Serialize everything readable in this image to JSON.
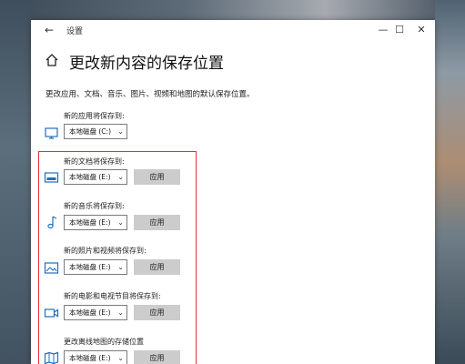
{
  "window": {
    "title": "设置",
    "back_glyph": "←",
    "minimize_glyph": "—",
    "maximize_glyph": "☐",
    "close_glyph": "✕"
  },
  "page": {
    "title": "更改新内容的保存位置",
    "description": "更改应用、文档、音乐、图片、视频和地图的默认保存位置。"
  },
  "rows": [
    {
      "label": "新的应用将保存到:",
      "drive": "本地磁盘 (C:)",
      "apply": "",
      "icon": "monitor-icon"
    },
    {
      "label": "新的文档将保存到:",
      "drive": "本地磁盘 (E:)",
      "apply": "应用",
      "icon": "document-drive-icon"
    },
    {
      "label": "新的音乐将保存到:",
      "drive": "本地磁盘 (E:)",
      "apply": "应用",
      "icon": "music-note-icon"
    },
    {
      "label": "新的照片和视频将保存到:",
      "drive": "本地磁盘 (E:)",
      "apply": "应用",
      "icon": "picture-icon"
    },
    {
      "label": "新的电影和电视节目将保存到:",
      "drive": "本地磁盘 (E:)",
      "apply": "应用",
      "icon": "video-camera-icon"
    },
    {
      "label": "更改离线地图的存储位置",
      "drive": "本地磁盘 (E:)",
      "apply": "应用",
      "icon": "map-icon"
    }
  ],
  "colors": {
    "highlight_border": "#d9343c",
    "apply_button_bg": "#cccccc",
    "icon_blue": "#1f6fbf"
  }
}
